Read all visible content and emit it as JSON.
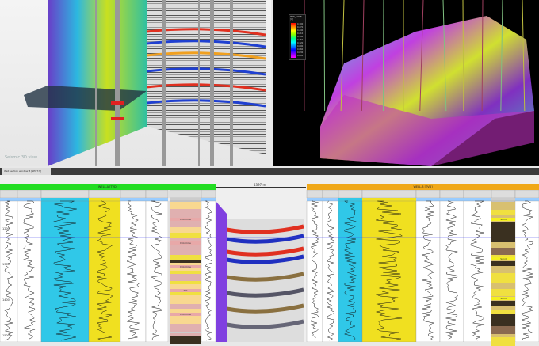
{
  "viewer_3d_left": {
    "watermark": "Seismic 3D view"
  },
  "viewer_3d_right": {
    "legend_title": "PHIE_COMB [U]",
    "legend_values": [
      "0.300",
      "0.270",
      "0.240",
      "0.210",
      "0.180",
      "0.150",
      "0.120",
      "0.090",
      "0.060",
      "0.030",
      "0.000"
    ]
  },
  "tab": {
    "label": "Well section window 8 [SECT:3]"
  },
  "section": {
    "distance_label": "4397 m",
    "well_left": {
      "name": "WELL-A [TVD]",
      "color": "#22dd22"
    },
    "well_right": {
      "name": "WELL-B [TVD]",
      "color": "#f0a818"
    },
    "depths": [
      "1200",
      "1300",
      "1400",
      "1500"
    ],
    "lithology_left": [
      "Dolomite",
      "Dolomite",
      "Dolomite",
      "Silt",
      "Dolomite"
    ],
    "lithology_right": [
      "Sand",
      "Sand",
      "Sand"
    ]
  },
  "colors": {
    "dark_bar": "#3c3c3c",
    "accent_blue": "#4444ee"
  }
}
